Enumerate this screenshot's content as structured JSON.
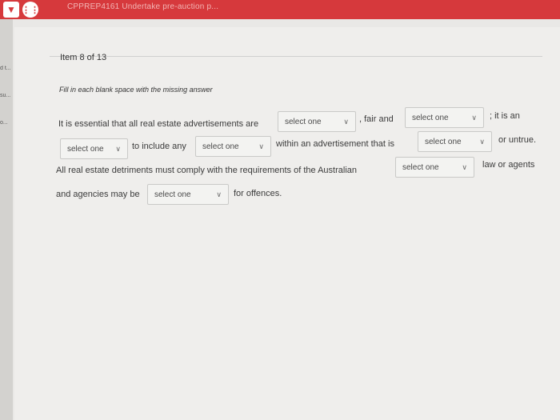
{
  "topbar": {
    "title": "CPPREP4161 Undertake pre-auction p...",
    "menu_icon": "chevron-down-icon",
    "apps_icon": "grid-icon",
    "color": "#d6393c"
  },
  "leftnav": {
    "stubs": [
      "d t...",
      "su...",
      "o...",
      "",
      ""
    ]
  },
  "question": {
    "header": "Item 8 of 13",
    "instruction": "Fill in each blank space with the missing answer",
    "line1_a": "It is essential that all real estate advertisements are",
    "line1_b": ", fair and",
    "line1_c": "; it is an",
    "line2_a": "to include any",
    "line2_b": "within an advertisement that is",
    "line2_c": "or untrue.",
    "line3_a": "All real estate detriments must comply with the requirements of the Australian",
    "line3_b": "law or agents",
    "line4_a": "and agencies may be",
    "line4_b": "for offences."
  },
  "selects": {
    "s1": "select one",
    "s2": "select one",
    "s3": "select one",
    "s4": "select one",
    "s5": "select one",
    "s6": "select one",
    "s7": "select one"
  }
}
